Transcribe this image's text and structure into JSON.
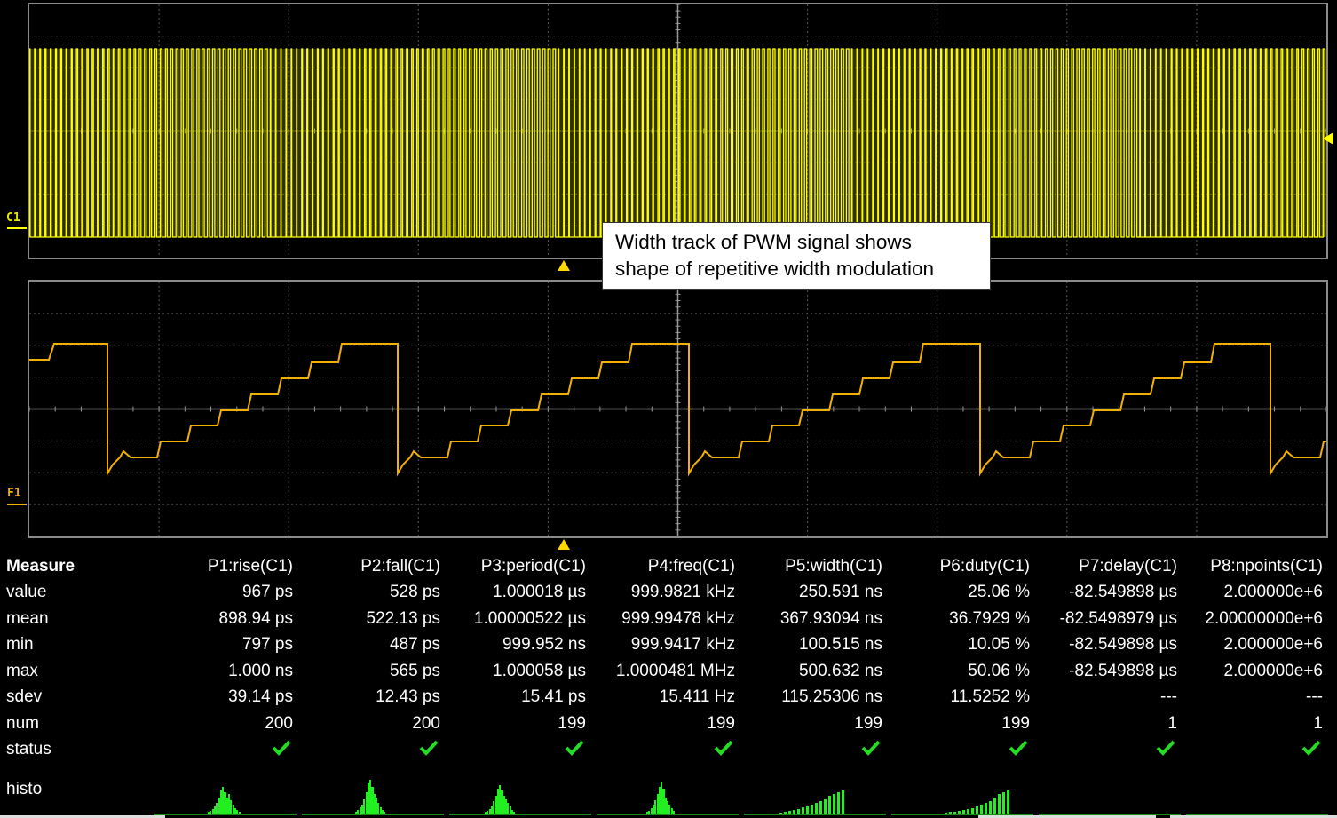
{
  "traces": {
    "c1": {
      "label": "C1",
      "color": "#ffff00"
    },
    "f1": {
      "label": "F1",
      "color": "#f2b000"
    }
  },
  "annotation": {
    "line1": "Width track of PWM signal shows",
    "line2": "shape of repetitive width modulation"
  },
  "measure": {
    "title": "Measure",
    "columns": [
      "P1:rise(C1)",
      "P2:fall(C1)",
      "P3:period(C1)",
      "P4:freq(C1)",
      "P5:width(C1)",
      "P6:duty(C1)",
      "P7:delay(C1)",
      "P8:npoints(C1)"
    ],
    "rows": [
      {
        "label": "value",
        "cells": [
          "967 ps",
          "528 ps",
          "1.000018 µs",
          "999.9821 kHz",
          "250.591 ns",
          "25.06 %",
          "-82.549898 µs",
          "2.000000e+6"
        ]
      },
      {
        "label": "mean",
        "cells": [
          "898.94 ps",
          "522.13 ps",
          "1.00000522 µs",
          "999.99478 kHz",
          "367.93094 ns",
          "36.7929 %",
          "-82.5498979 µs",
          "2.00000000e+6"
        ]
      },
      {
        "label": "min",
        "cells": [
          "797 ps",
          "487 ps",
          "999.952 ns",
          "999.9417 kHz",
          "100.515 ns",
          "10.05 %",
          "-82.549898 µs",
          "2.000000e+6"
        ]
      },
      {
        "label": "max",
        "cells": [
          "1.000 ns",
          "565 ps",
          "1.000058 µs",
          "1.0000481 MHz",
          "500.632 ns",
          "50.06 %",
          "-82.549898 µs",
          "2.000000e+6"
        ]
      },
      {
        "label": "sdev",
        "cells": [
          "39.14 ps",
          "12.43 ps",
          "15.41 ps",
          "15.411 Hz",
          "115.25306 ns",
          "11.5252 %",
          "---",
          "---"
        ]
      },
      {
        "label": "num",
        "cells": [
          "200",
          "200",
          "199",
          "199",
          "199",
          "199",
          "1",
          "1"
        ]
      }
    ],
    "status_label": "status",
    "histo_label": "histo",
    "check_color": "#22dd22",
    "histo_color": "#22ee22"
  }
}
